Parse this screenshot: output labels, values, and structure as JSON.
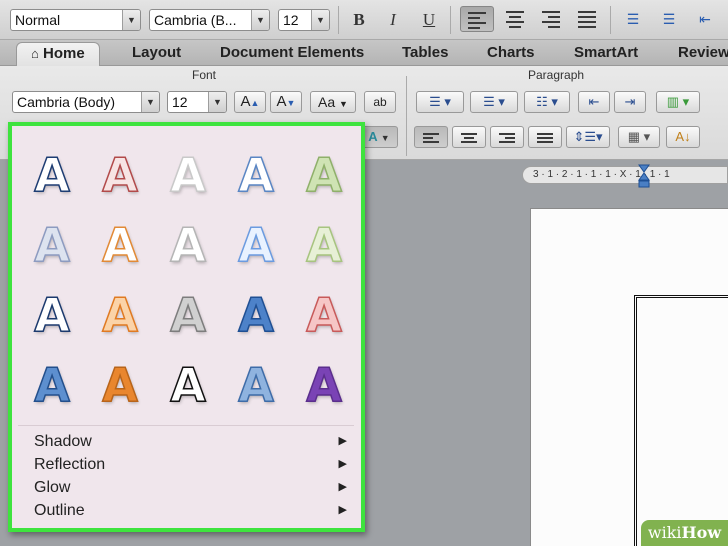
{
  "toolbar": {
    "style_value": "Normal",
    "font_value": "Cambria (B...",
    "size_value": "12",
    "bold_label": "B",
    "italic_label": "I",
    "underline_label": "U"
  },
  "tabs": [
    {
      "label": "Home",
      "active": true
    },
    {
      "label": "Layout"
    },
    {
      "label": "Document Elements"
    },
    {
      "label": "Tables"
    },
    {
      "label": "Charts"
    },
    {
      "label": "SmartArt"
    },
    {
      "label": "Review"
    }
  ],
  "ribbon": {
    "font_group_title": "Font",
    "paragraph_group_title": "Paragraph",
    "font_value": "Cambria (Body)",
    "size_value": "12",
    "grow_font_label": "A",
    "shrink_font_label": "A",
    "change_case_label": "Aa",
    "clear_format_label": "ab"
  },
  "ruler": {
    "text": "3 · 1 · 2 · 1 · 1 · 1 · X · 1 · 1 · 1"
  },
  "text_effects_popup": {
    "glyph": "A",
    "styles": [
      {
        "name": "outline-blue",
        "fill": "#ffffff",
        "stroke": "#1e3d73"
      },
      {
        "name": "outline-red",
        "fill": "#f7e4e4",
        "stroke": "#b24a4a"
      },
      {
        "name": "white-shadow",
        "fill": "#ffffff",
        "stroke": "#c9c9c9"
      },
      {
        "name": "white-blue-outline",
        "fill": "#ffffff",
        "stroke": "#5a86c4"
      },
      {
        "name": "light-green",
        "fill": "#cfe3b4",
        "stroke": "#8fb06a"
      },
      {
        "name": "faded-blue",
        "fill": "#dde3ef",
        "stroke": "#8d9bc0"
      },
      {
        "name": "white-orange",
        "fill": "#ffffff",
        "stroke": "#e28a36"
      },
      {
        "name": "white-gray",
        "fill": "#ffffff",
        "stroke": "#b5b5b5"
      },
      {
        "name": "glow-blue",
        "fill": "#e9f2ff",
        "stroke": "#6b9be0"
      },
      {
        "name": "pale-green",
        "fill": "#e7f0d6",
        "stroke": "#a7c47f"
      },
      {
        "name": "dark-blue-outline",
        "fill": "#ffffff",
        "stroke": "#1c3a6e"
      },
      {
        "name": "orange-bevel",
        "fill": "#fbd3a8",
        "stroke": "#e07a22"
      },
      {
        "name": "gray-metal",
        "fill": "#d0d0d0",
        "stroke": "#7d7d7d"
      },
      {
        "name": "blue-gradient",
        "fill": "#4d82c9",
        "stroke": "#1f4f93"
      },
      {
        "name": "red-bevel",
        "fill": "#f6c6c6",
        "stroke": "#c85a5a"
      },
      {
        "name": "blue-fill",
        "fill": "#5d8fcf",
        "stroke": "#234f8c"
      },
      {
        "name": "orange-fill",
        "fill": "#e9862e",
        "stroke": "#b8641a"
      },
      {
        "name": "black-white",
        "fill": "#ffffff",
        "stroke": "#111111"
      },
      {
        "name": "blue-reflection",
        "fill": "#8fb3df",
        "stroke": "#3e6ca8"
      },
      {
        "name": "purple-fill",
        "fill": "#7a43b5",
        "stroke": "#5b2e8d"
      }
    ],
    "menu_items": [
      {
        "label": "Shadow"
      },
      {
        "label": "Reflection"
      },
      {
        "label": "Glow"
      },
      {
        "label": "Outline"
      }
    ]
  },
  "watermark": {
    "brand_a": "wiki",
    "brand_b": "How"
  },
  "colors": {
    "highlight_border": "#3ee33e",
    "popup_bg": "#f0e6ec"
  }
}
